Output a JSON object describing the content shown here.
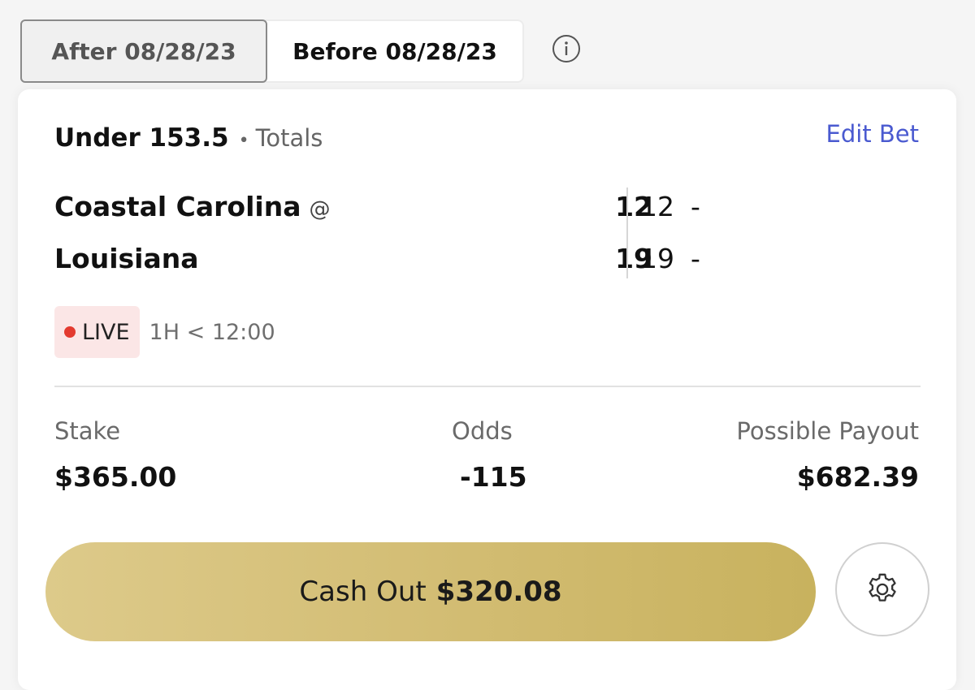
{
  "date_toggle": {
    "after_label": "After 08/28/23",
    "before_label": "Before 08/28/23",
    "selected": "after"
  },
  "icons": {
    "info": "info-circle-icon",
    "settings": "gear-icon",
    "live_indicator": "red-dot-icon"
  },
  "bet": {
    "selection": "Under 153.5",
    "separator": "•",
    "market": "Totals",
    "edit_label": "Edit Bet"
  },
  "game": {
    "away_team": "Coastal Carolina",
    "at_symbol": "@",
    "home_team": "Louisiana",
    "away_total": "12",
    "away_half": "12",
    "away_second": "-",
    "home_total": "19",
    "home_half": "19",
    "home_second": "-"
  },
  "status": {
    "live_label": "LIVE",
    "period": "1H < 12:00"
  },
  "summary": {
    "stake_label": "Stake",
    "stake_value": "$365.00",
    "odds_label": "Odds",
    "odds_value": "-115",
    "payout_label": "Possible Payout",
    "payout_value": "$682.39"
  },
  "cashout": {
    "label": "Cash Out",
    "amount": "$320.08"
  },
  "colors": {
    "accent_link": "#4a5ad0",
    "cashout_gold": "#d2bc72",
    "live_red": "#e33a2f",
    "live_bg": "#fbe6e6"
  }
}
